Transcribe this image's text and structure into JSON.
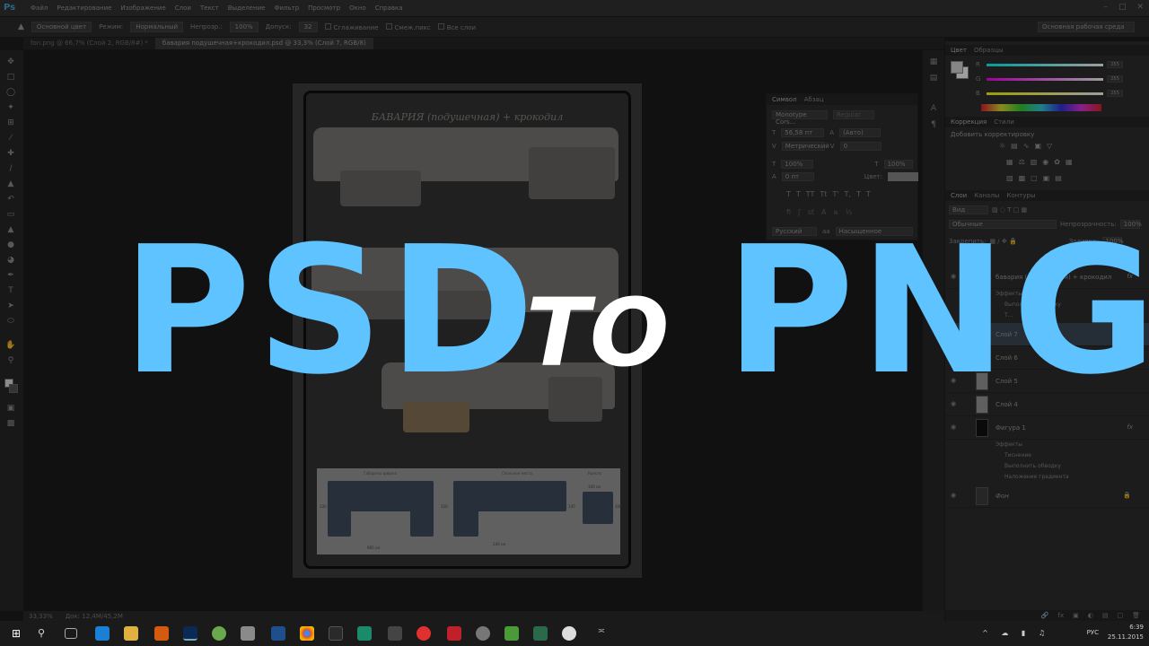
{
  "app": {
    "logo": "Ps"
  },
  "menu": [
    "Файл",
    "Редактирование",
    "Изображение",
    "Слои",
    "Текст",
    "Выделение",
    "Фильтр",
    "Просмотр",
    "Окно",
    "Справка"
  ],
  "options": {
    "source": "Основной цвет",
    "mode_label": "Режим:",
    "mode": "Нормальный",
    "opacity_label": "Непрозр.:",
    "opacity": "100%",
    "tolerance_label": "Допуск:",
    "tolerance": "32",
    "antialias": "Сглаживание",
    "contiguous": "Смеж.пикс",
    "all_layers": "Все слои",
    "workspace": "Основная рабочая среда"
  },
  "tabs": [
    "fon.png @ 66,7% (Слой 2, RGB/8#) *",
    "бавария подушечная+крокодил.psd @ 33,3% (Слой 7, RGB/8)"
  ],
  "document": {
    "title": "БАВАРИЯ (подушечная) + крокодил",
    "dims_labels": [
      "Габариты дивана",
      "Спальное место",
      "Кресло"
    ],
    "dim_values": [
      "985 см",
      "240 см",
      "100 см",
      "330",
      "320",
      "145",
      "100"
    ]
  },
  "status": {
    "zoom": "33,33%",
    "doc": "Док: 12,4M/45,2M"
  },
  "character_panel": {
    "tabs": [
      "Символ",
      "Абзац"
    ],
    "font": "Monotype Cors...",
    "style": "Regular",
    "size": "56,58 пт",
    "leading": "(Авто)",
    "kerning": "Метрический",
    "tracking": "0",
    "vscale": "100%",
    "hscale": "100%",
    "baseline": "0 пт",
    "color_label": "Цвет:",
    "language": "Русский",
    "aa_label": "aa",
    "aa": "Насыщенное"
  },
  "color_panel": {
    "tabs": [
      "Цвет",
      "Образцы"
    ],
    "channels": [
      {
        "ch": "R",
        "val": "255",
        "color": "#cc3333"
      },
      {
        "ch": "G",
        "val": "255",
        "color": "#33aa33"
      },
      {
        "ch": "B",
        "val": "255",
        "color": "#3355cc"
      }
    ]
  },
  "adjustments": {
    "tabs": [
      "Коррекция",
      "Стили"
    ],
    "add": "Добавить корректировку"
  },
  "layers_panel": {
    "tabs": [
      "Слои",
      "Каналы",
      "Контуры"
    ],
    "kind": "Вид",
    "blend": "Обычные",
    "opacity_label": "Непрозрачность:",
    "opacity": "100%",
    "lock_label": "Закрепить:",
    "fill_label": "Заливка:",
    "fill": "100%",
    "layers": [
      {
        "name": "бавария (подушечная) + крокодил",
        "fx": "fx",
        "type": "text"
      },
      {
        "name": "Слой 7",
        "type": "pixel",
        "selected": true
      },
      {
        "name": "Слой 6",
        "type": "pixel"
      },
      {
        "name": "Слой 5",
        "type": "pixel"
      },
      {
        "name": "Слой 4",
        "type": "pixel"
      },
      {
        "name": "Фигура 1",
        "fx": "fx",
        "type": "shape"
      },
      {
        "name": "Фон",
        "type": "bg"
      }
    ],
    "effects_1": [
      "Эффекты",
      "Выполнить обводку",
      "Т..."
    ],
    "effects_2": [
      "Эффекты",
      "Тиснение",
      "Выполнить обводку",
      "Наложение градиента"
    ]
  },
  "overlay": {
    "left": "PSD",
    "mid": "TO",
    "right": "PNG"
  },
  "taskbar": {
    "lang": "РУС",
    "time": "6:39",
    "date": "25.11.2015"
  }
}
